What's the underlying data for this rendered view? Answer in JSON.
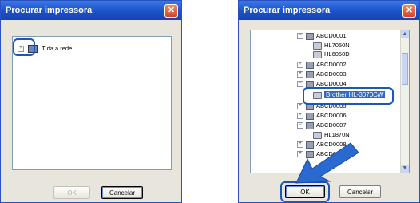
{
  "left_dialog": {
    "title": "Procurar impressora",
    "close_glyph": "✕",
    "tree": [
      {
        "toggle": "+",
        "icon": "network-icon",
        "label": "T da a rede"
      }
    ],
    "ok_label": "OK",
    "cancel_label": "Cancelar"
  },
  "right_dialog": {
    "title": "Procurar impressora",
    "close_glyph": "✕",
    "tree": [
      {
        "label": "ABCD0001"
      },
      {
        "label": "HL7050N"
      },
      {
        "label": "HL6050D"
      },
      {
        "label": "ABCD0002"
      },
      {
        "label": "ABCD0003"
      },
      {
        "label": "ABCD0004"
      },
      {
        "label": "Brother HL-3070CW"
      },
      {
        "label": "ABCD0005"
      },
      {
        "label": "ABCD0006"
      },
      {
        "label": "ABCD0007"
      },
      {
        "label": "HL1870N"
      },
      {
        "label": "ABCD0008"
      },
      {
        "label": "ABCD00"
      }
    ],
    "ok_label": "OK",
    "cancel_label": "Cancelar",
    "scroll_up": "▲",
    "scroll_down": "▼"
  },
  "colors": {
    "accent": "#1d57b2",
    "selection": "#316ac5",
    "titlebar": "#1a52c8"
  }
}
